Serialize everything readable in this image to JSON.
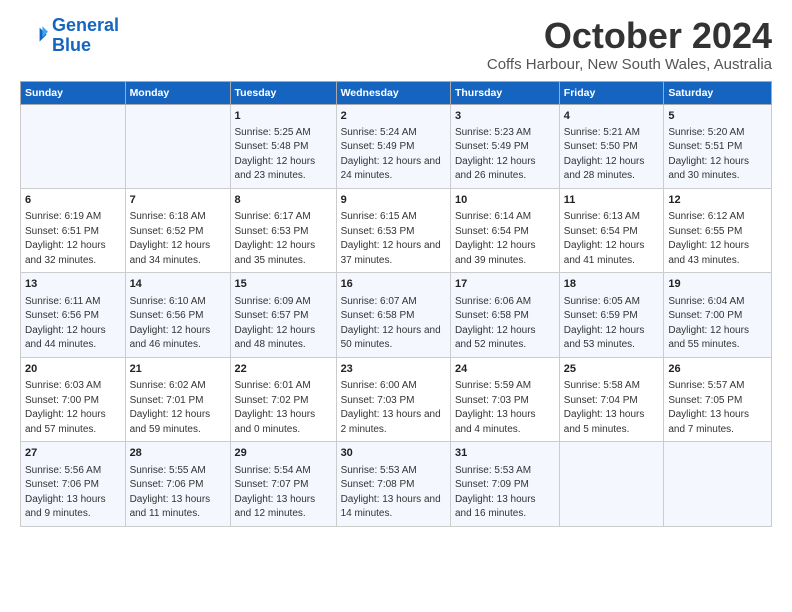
{
  "logo": {
    "line1": "General",
    "line2": "Blue"
  },
  "title": "October 2024",
  "subtitle": "Coffs Harbour, New South Wales, Australia",
  "days_header": [
    "Sunday",
    "Monday",
    "Tuesday",
    "Wednesday",
    "Thursday",
    "Friday",
    "Saturday"
  ],
  "weeks": [
    [
      {
        "day": "",
        "info": ""
      },
      {
        "day": "",
        "info": ""
      },
      {
        "day": "1",
        "info": "Sunrise: 5:25 AM\nSunset: 5:48 PM\nDaylight: 12 hours and 23 minutes."
      },
      {
        "day": "2",
        "info": "Sunrise: 5:24 AM\nSunset: 5:49 PM\nDaylight: 12 hours and 24 minutes."
      },
      {
        "day": "3",
        "info": "Sunrise: 5:23 AM\nSunset: 5:49 PM\nDaylight: 12 hours and 26 minutes."
      },
      {
        "day": "4",
        "info": "Sunrise: 5:21 AM\nSunset: 5:50 PM\nDaylight: 12 hours and 28 minutes."
      },
      {
        "day": "5",
        "info": "Sunrise: 5:20 AM\nSunset: 5:51 PM\nDaylight: 12 hours and 30 minutes."
      }
    ],
    [
      {
        "day": "6",
        "info": "Sunrise: 6:19 AM\nSunset: 6:51 PM\nDaylight: 12 hours and 32 minutes."
      },
      {
        "day": "7",
        "info": "Sunrise: 6:18 AM\nSunset: 6:52 PM\nDaylight: 12 hours and 34 minutes."
      },
      {
        "day": "8",
        "info": "Sunrise: 6:17 AM\nSunset: 6:53 PM\nDaylight: 12 hours and 35 minutes."
      },
      {
        "day": "9",
        "info": "Sunrise: 6:15 AM\nSunset: 6:53 PM\nDaylight: 12 hours and 37 minutes."
      },
      {
        "day": "10",
        "info": "Sunrise: 6:14 AM\nSunset: 6:54 PM\nDaylight: 12 hours and 39 minutes."
      },
      {
        "day": "11",
        "info": "Sunrise: 6:13 AM\nSunset: 6:54 PM\nDaylight: 12 hours and 41 minutes."
      },
      {
        "day": "12",
        "info": "Sunrise: 6:12 AM\nSunset: 6:55 PM\nDaylight: 12 hours and 43 minutes."
      }
    ],
    [
      {
        "day": "13",
        "info": "Sunrise: 6:11 AM\nSunset: 6:56 PM\nDaylight: 12 hours and 44 minutes."
      },
      {
        "day": "14",
        "info": "Sunrise: 6:10 AM\nSunset: 6:56 PM\nDaylight: 12 hours and 46 minutes."
      },
      {
        "day": "15",
        "info": "Sunrise: 6:09 AM\nSunset: 6:57 PM\nDaylight: 12 hours and 48 minutes."
      },
      {
        "day": "16",
        "info": "Sunrise: 6:07 AM\nSunset: 6:58 PM\nDaylight: 12 hours and 50 minutes."
      },
      {
        "day": "17",
        "info": "Sunrise: 6:06 AM\nSunset: 6:58 PM\nDaylight: 12 hours and 52 minutes."
      },
      {
        "day": "18",
        "info": "Sunrise: 6:05 AM\nSunset: 6:59 PM\nDaylight: 12 hours and 53 minutes."
      },
      {
        "day": "19",
        "info": "Sunrise: 6:04 AM\nSunset: 7:00 PM\nDaylight: 12 hours and 55 minutes."
      }
    ],
    [
      {
        "day": "20",
        "info": "Sunrise: 6:03 AM\nSunset: 7:00 PM\nDaylight: 12 hours and 57 minutes."
      },
      {
        "day": "21",
        "info": "Sunrise: 6:02 AM\nSunset: 7:01 PM\nDaylight: 12 hours and 59 minutes."
      },
      {
        "day": "22",
        "info": "Sunrise: 6:01 AM\nSunset: 7:02 PM\nDaylight: 13 hours and 0 minutes."
      },
      {
        "day": "23",
        "info": "Sunrise: 6:00 AM\nSunset: 7:03 PM\nDaylight: 13 hours and 2 minutes."
      },
      {
        "day": "24",
        "info": "Sunrise: 5:59 AM\nSunset: 7:03 PM\nDaylight: 13 hours and 4 minutes."
      },
      {
        "day": "25",
        "info": "Sunrise: 5:58 AM\nSunset: 7:04 PM\nDaylight: 13 hours and 5 minutes."
      },
      {
        "day": "26",
        "info": "Sunrise: 5:57 AM\nSunset: 7:05 PM\nDaylight: 13 hours and 7 minutes."
      }
    ],
    [
      {
        "day": "27",
        "info": "Sunrise: 5:56 AM\nSunset: 7:06 PM\nDaylight: 13 hours and 9 minutes."
      },
      {
        "day": "28",
        "info": "Sunrise: 5:55 AM\nSunset: 7:06 PM\nDaylight: 13 hours and 11 minutes."
      },
      {
        "day": "29",
        "info": "Sunrise: 5:54 AM\nSunset: 7:07 PM\nDaylight: 13 hours and 12 minutes."
      },
      {
        "day": "30",
        "info": "Sunrise: 5:53 AM\nSunset: 7:08 PM\nDaylight: 13 hours and 14 minutes."
      },
      {
        "day": "31",
        "info": "Sunrise: 5:53 AM\nSunset: 7:09 PM\nDaylight: 13 hours and 16 minutes."
      },
      {
        "day": "",
        "info": ""
      },
      {
        "day": "",
        "info": ""
      }
    ]
  ]
}
